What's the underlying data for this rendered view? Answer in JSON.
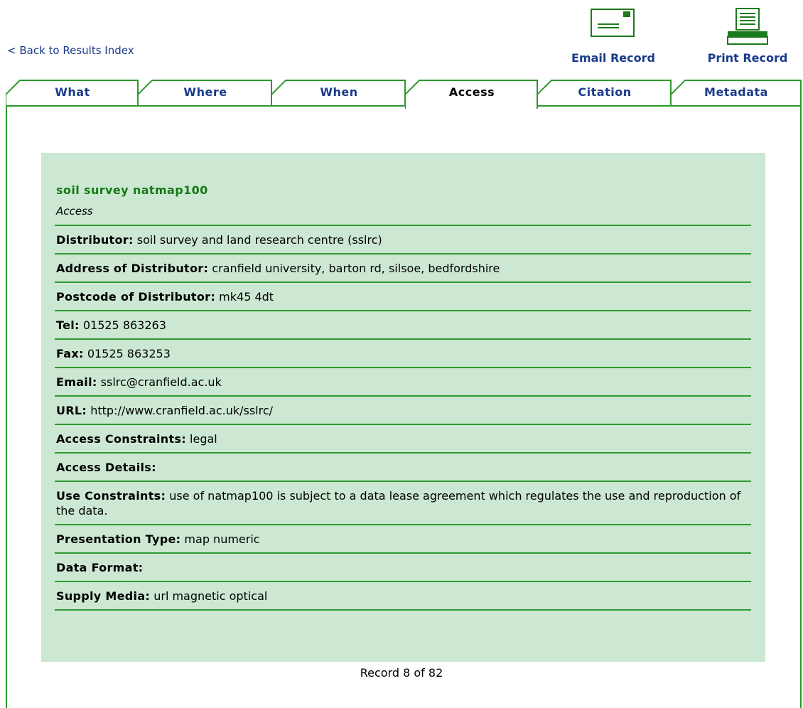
{
  "nav": {
    "back_label": "< Back to Results Index"
  },
  "actions": {
    "email_label": "Email Record",
    "print_label": "Print Record"
  },
  "tabs": [
    {
      "label": "What"
    },
    {
      "label": "Where"
    },
    {
      "label": "When"
    },
    {
      "label": "Access",
      "active": true
    },
    {
      "label": "Citation"
    },
    {
      "label": "Metadata"
    }
  ],
  "record": {
    "title": "soil survey natmap100",
    "section": "Access",
    "fields": [
      {
        "label": "Distributor:",
        "value": "soil survey and land research centre (sslrc)"
      },
      {
        "label": "Address of Distributor:",
        "value": "cranfield university, barton rd, silsoe, bedfordshire"
      },
      {
        "label": "Postcode of Distributor:",
        "value": "mk45 4dt"
      },
      {
        "label": "Tel:",
        "value": "01525 863263"
      },
      {
        "label": "Fax:",
        "value": "01525 863253"
      },
      {
        "label": "Email:",
        "value": "sslrc@cranfield.ac.uk"
      },
      {
        "label": "URL:",
        "value": "http://www.cranfield.ac.uk/sslrc/"
      },
      {
        "label": "Access Constraints:",
        "value": "legal"
      },
      {
        "label": "Access Details:",
        "value": ""
      },
      {
        "label": "Use Constraints:",
        "value": "use of natmap100 is subject to a data lease agreement which regulates the use and reproduction of the data."
      },
      {
        "label": "Presentation Type:",
        "value": "map numeric"
      },
      {
        "label": "Data Format:",
        "value": ""
      },
      {
        "label": "Supply Media:",
        "value": "url magnetic optical"
      }
    ]
  },
  "footer": {
    "record_count": "Record 8 of 82"
  },
  "colors": {
    "accent_green": "#2c9a2c",
    "title_green": "#137a13",
    "panel_bg": "#cce8d2",
    "link_blue": "#1a3a8a"
  }
}
